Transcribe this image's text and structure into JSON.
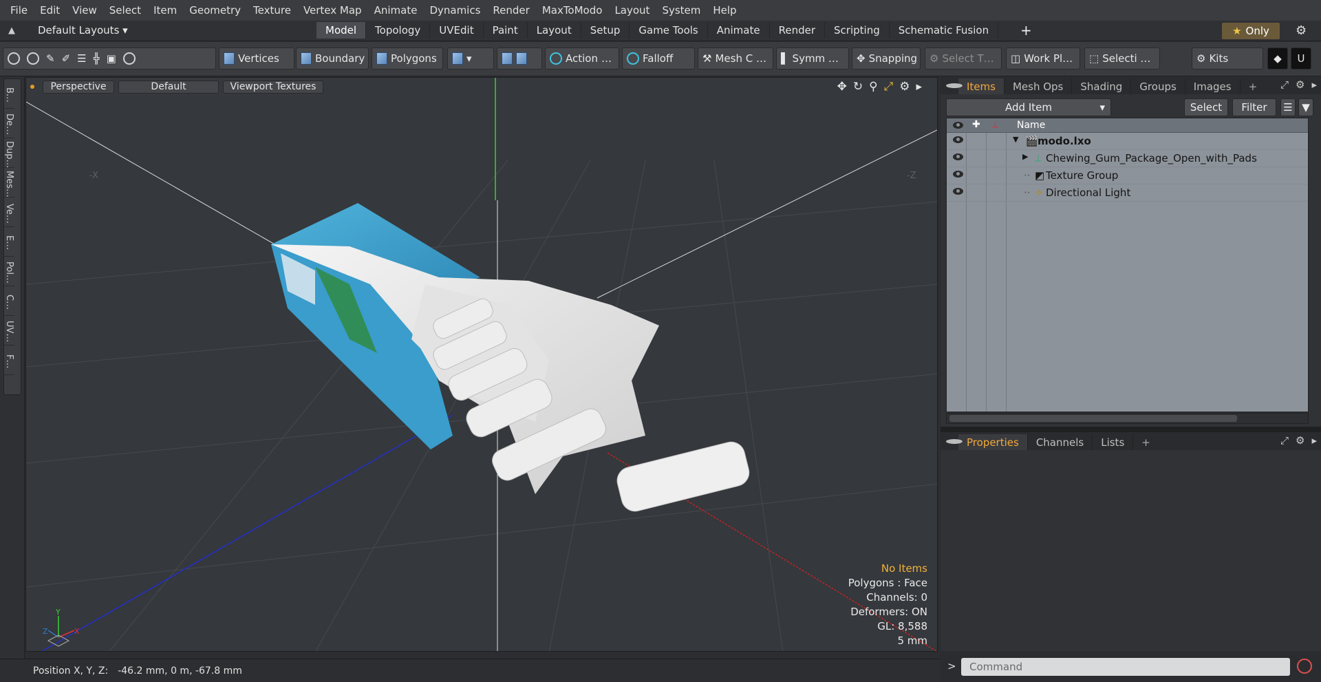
{
  "menu": [
    "File",
    "Edit",
    "View",
    "Select",
    "Item",
    "Geometry",
    "Texture",
    "Vertex Map",
    "Animate",
    "Dynamics",
    "Render",
    "MaxToModo",
    "Layout",
    "System",
    "Help"
  ],
  "layout": {
    "default_layouts": "Default Layouts ▾",
    "tabs": [
      "Model",
      "Topology",
      "UVEdit",
      "Paint",
      "Layout",
      "Setup",
      "Game Tools",
      "Animate",
      "Render",
      "Scripting",
      "Schematic Fusion"
    ],
    "active_tab": "Model",
    "only": "Only"
  },
  "toolbar": {
    "vertices": "Vertices",
    "boundary": "Boundary",
    "polygons": "Polygons",
    "action": "Action",
    "falloff": "Falloff",
    "mesh_c": "Mesh C …",
    "symm": "Symm …",
    "snapping": "Snapping",
    "select_t": "Select T…",
    "work_pl": "Work Pl…",
    "selecti": "Selecti …",
    "kits": "Kits"
  },
  "left_tabs": [
    "B…",
    "De…",
    "Dup…",
    "Mes…",
    "Ve…",
    "E…",
    "Pol…",
    "C…",
    "UV…",
    "F…"
  ],
  "viewport": {
    "perspective": "Perspective",
    "default": "Default",
    "textures": "Viewport Textures",
    "axis_labels": {
      "neg_x": "-X",
      "neg_z": "-Z",
      "y": "Y",
      "z": "Z",
      "x": "X"
    }
  },
  "stats": {
    "no_items": "No Items",
    "polygons": "Polygons : Face",
    "channels": "Channels: 0",
    "deformers": "Deformers: ON",
    "gl": "GL: 8,588",
    "scale": "5 mm"
  },
  "status": {
    "label": "Position X, Y, Z:",
    "value": "-46.2 mm, 0 m, -67.8 mm"
  },
  "items_panel": {
    "tabs": [
      "Items",
      "Mesh Ops",
      "Shading",
      "Groups",
      "Images"
    ],
    "add_item": "Add Item",
    "select": "Select",
    "filter": "Filter",
    "col_name": "Name",
    "rows": [
      {
        "name": "modo.lxo",
        "bold": true
      },
      {
        "name": "Chewing_Gum_Package_Open_with_Pads"
      },
      {
        "name": "Texture Group"
      },
      {
        "name": "Directional Light"
      }
    ]
  },
  "props_panel": {
    "tabs": [
      "Properties",
      "Channels",
      "Lists"
    ]
  },
  "command": {
    "placeholder": "Command",
    "prompt": ">"
  }
}
